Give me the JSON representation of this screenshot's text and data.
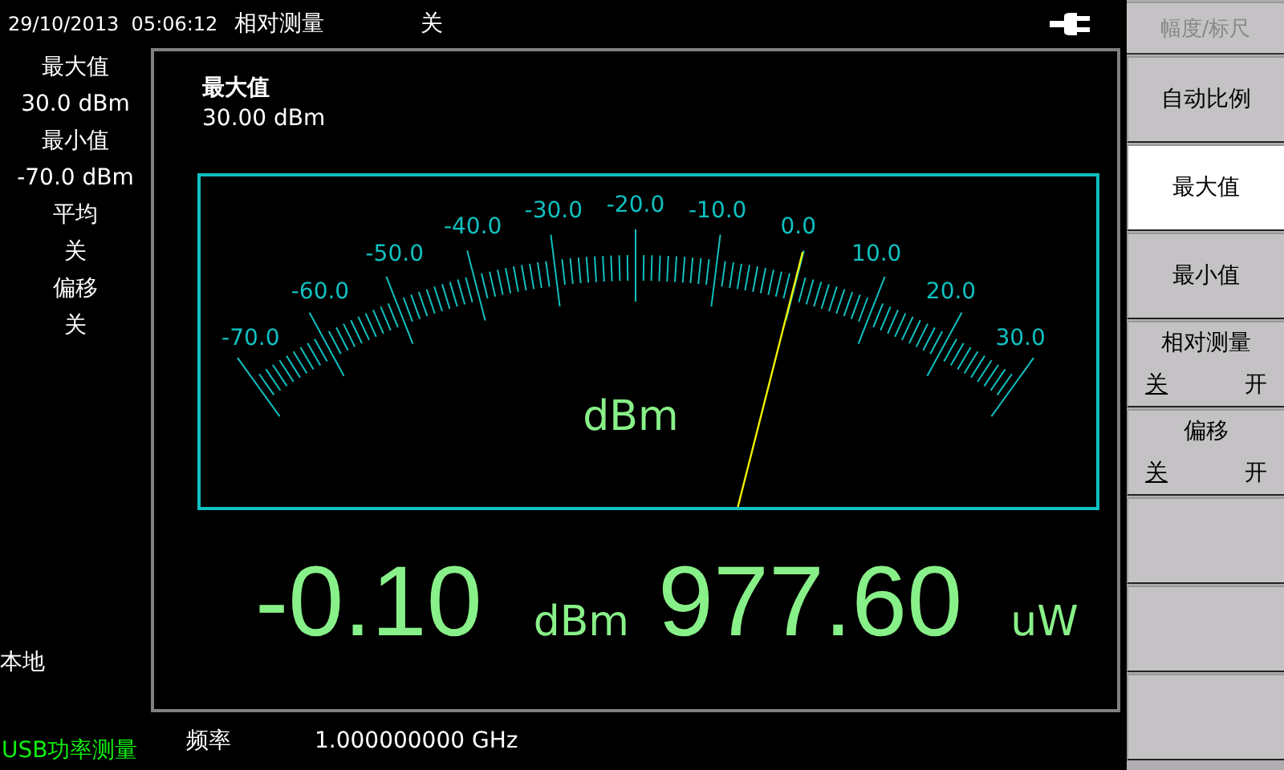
{
  "top_bar": {
    "datetime": "29/10/2013  05:06:12",
    "mode_label": "相对测量",
    "mode_value": "关"
  },
  "left_panel": {
    "items": [
      {
        "label": "最大值",
        "value": "30.0 dBm"
      },
      {
        "label": "最小值",
        "value": "-70.0 dBm"
      },
      {
        "label": "平均",
        "value": "关"
      },
      {
        "label": "偏移",
        "value": "关"
      }
    ],
    "control_mode": "本地",
    "measurement_mode": "USB功率测量"
  },
  "main": {
    "setting_label": "最大值",
    "setting_value": "30.00 dBm",
    "meter": {
      "scale_labels": [
        "-70.0",
        "-60.0",
        "-50.0",
        "-40.0",
        "-30.0",
        "-20.0",
        "-10.0",
        "0.0",
        "10.0",
        "20.0",
        "30.0"
      ],
      "unit": "dBm",
      "level": 0.699
    },
    "reading_dbm": "-0.10",
    "reading_dbm_unit": "dBm",
    "reading_power": "977.60",
    "reading_power_unit": "uW"
  },
  "frequency": {
    "label": "频率",
    "value": "1.000000000 GHz"
  },
  "softkeys": {
    "title": "幅度/标尺",
    "keys": [
      {
        "kind": "label",
        "label": "自动比例",
        "selected": false
      },
      {
        "kind": "label",
        "label": "最大值",
        "selected": true
      },
      {
        "kind": "label",
        "label": "最小值",
        "selected": false
      },
      {
        "kind": "toggle",
        "label": "相对测量",
        "off_text": "关",
        "on_text": "开",
        "on": false,
        "selected": false
      },
      {
        "kind": "toggle",
        "label": "偏移",
        "off_text": "关",
        "on_text": "开",
        "on": false,
        "selected": false
      },
      {
        "kind": "blank",
        "selected": false
      },
      {
        "kind": "blank",
        "selected": false
      },
      {
        "kind": "blank",
        "selected": false
      }
    ]
  }
}
